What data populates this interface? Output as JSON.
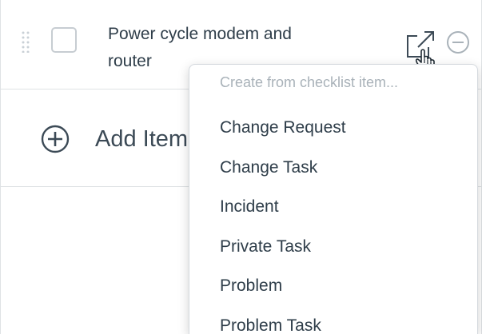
{
  "checklist": {
    "item": {
      "text": "Power cycle modem and router",
      "checked": false,
      "drag_icon": "drag-handle-icon",
      "open_icon": "open-record-icon",
      "remove_icon": "remove-circle-icon"
    },
    "add_item": {
      "label": "Add Item",
      "icon": "add-circle-icon"
    }
  },
  "menu": {
    "header": "Create from checklist item...",
    "items": [
      "Change Request",
      "Change Task",
      "Incident",
      "Private Task",
      "Problem",
      "Problem Task"
    ]
  },
  "colors": {
    "text": "#2e3d49",
    "muted": "#a9b2b9",
    "border": "#dfe2e5",
    "icon": "#3c4a56"
  }
}
